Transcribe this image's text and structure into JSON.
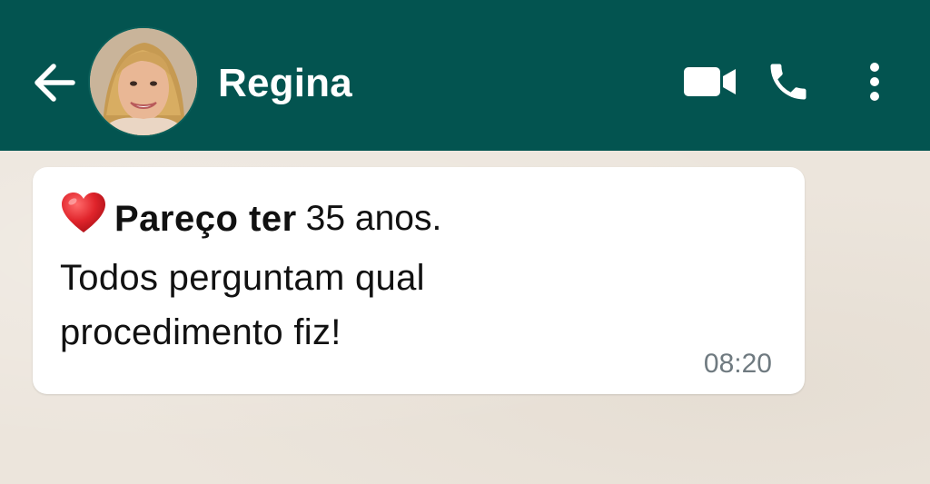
{
  "header": {
    "back_icon": "arrow-left-icon",
    "contact_name": "Regina",
    "actions": [
      {
        "icon": "video-call-icon"
      },
      {
        "icon": "phone-icon"
      },
      {
        "icon": "more-vertical-icon"
      }
    ],
    "background_color": "#035450"
  },
  "message": {
    "emoji": "red-heart-icon",
    "bold_text": "Pareço ter",
    "text_rest": "35 anos.",
    "line2": "Todos perguntam qual",
    "line3": "procedimento fiz!",
    "time": "08:20"
  }
}
